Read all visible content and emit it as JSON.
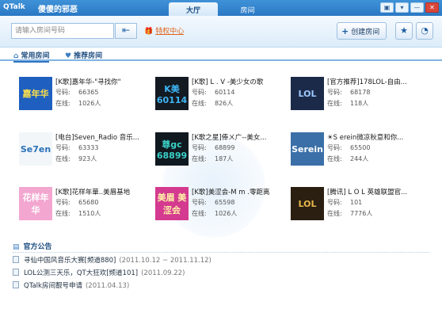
{
  "titlebar": {
    "brand": "QTalk",
    "user": "傻傻的邪恶",
    "tabs": [
      {
        "label": "大厅",
        "active": true
      },
      {
        "label": "房间",
        "active": false
      }
    ],
    "window_buttons": [
      "▣",
      "▾",
      "—",
      "✕"
    ]
  },
  "toolbar": {
    "search_placeholder": "请输入房间号码",
    "enter_icon": "⇤",
    "privilege_label": "特权中心",
    "create_label": "创建房间",
    "star_icon": "★",
    "clock_icon": "◔"
  },
  "subtabs": [
    {
      "label": "常用房间",
      "icon": "home-icon",
      "active": true
    },
    {
      "label": "推荐房间",
      "icon": "heart-icon",
      "active": false
    }
  ],
  "rooms": [
    {
      "title": "[K歌]嘉年华-\"寻找你\"",
      "number": "66365",
      "online": "1026人",
      "thumb_text": "嘉年华",
      "thumb_bg": "#1f5fc0",
      "thumb_fg": "#ffe14a"
    },
    {
      "title": "[K歌] L . V -美少女の歌",
      "number": "60114",
      "online": "826人",
      "thumb_text": "K美 60114",
      "thumb_bg": "#141a22",
      "thumb_fg": "#3fb6f5"
    },
    {
      "title": "[官方推荐]178LOL-自由...",
      "number": "68178",
      "online": "118人",
      "thumb_text": "LOL",
      "thumb_bg": "#1c2a4a",
      "thumb_fg": "#9ec9ff"
    },
    {
      "title": "[电台]Seven_Radio 音乐...",
      "number": "63333",
      "online": "923人",
      "thumb_text": "Se7en",
      "thumb_bg": "#f2f6f9",
      "thumb_fg": "#2c72b8"
    },
    {
      "title": "[K歌之星]俸ㄨ广--美女...",
      "number": "68899",
      "online": "187人",
      "thumb_text": "尊gc 68899",
      "thumb_bg": "#101820",
      "thumb_fg": "#3ad1c7"
    },
    {
      "title": "☀S erein微凉秋意和你...",
      "number": "65500",
      "online": "244人",
      "thumb_text": "Serein",
      "thumb_bg": "#3b6fa8",
      "thumb_fg": "#ffffff"
    },
    {
      "title": "[K歌]花样年華..美眉基地",
      "number": "65680",
      "online": "1510人",
      "thumb_text": "花样年华",
      "thumb_bg": "#f3a6cf",
      "thumb_fg": "#ffffff"
    },
    {
      "title": "[K歌]美涩会-M m .零距离",
      "number": "65598",
      "online": "1026人",
      "thumb_text": "美眉 美涩会",
      "thumb_bg": "#d43a8f",
      "thumb_fg": "#fff2a8"
    },
    {
      "title": "[腾讯] L O L 英雄联盟官...",
      "number": "101",
      "online": "7776人",
      "thumb_text": "LOL",
      "thumb_bg": "#2b1f12",
      "thumb_fg": "#e6b84a"
    }
  ],
  "labels": {
    "number": "号码:",
    "online": "在线:"
  },
  "announcements": {
    "title": "官方公告",
    "items": [
      {
        "text": "寻仙中国风音乐大赛[频道880]",
        "date": "(2011.10.12 ~ 2011.11.12)"
      },
      {
        "text": "LOL公测三天乐，QT大狂欢[频道101]",
        "date": "(2011.09.22)"
      },
      {
        "text": "QTalk房间靓号申请",
        "date": "(2011.04.13)"
      }
    ]
  }
}
